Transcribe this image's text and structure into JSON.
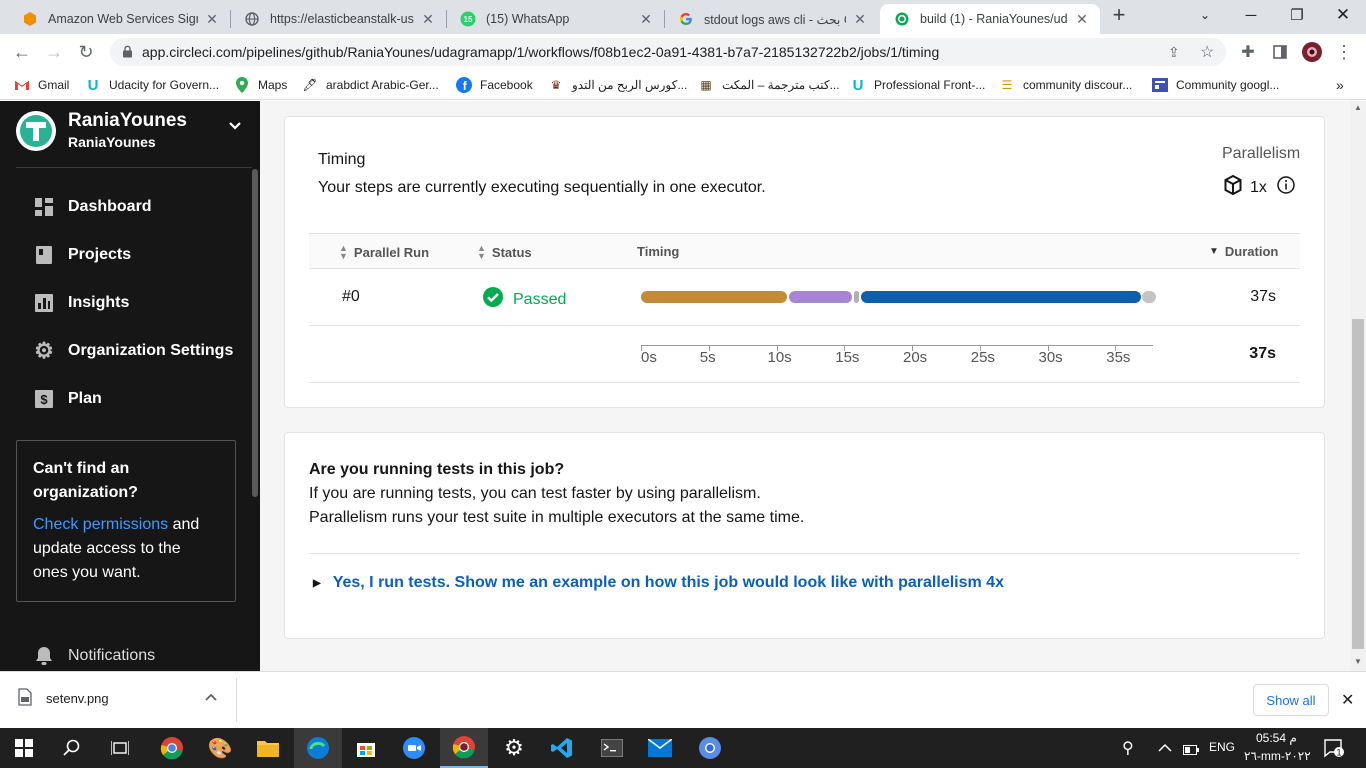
{
  "browser": {
    "tabs": [
      {
        "title": "Amazon Web Services Sign-I",
        "favicon": "aws-icon",
        "color": "#f29100"
      },
      {
        "title": "https://elasticbeanstalk-us-ea",
        "favicon": "globe-icon",
        "color": "#5f6368"
      },
      {
        "title": "(15) WhatsApp",
        "favicon": "whatsapp-icon",
        "color": "#25d366",
        "badge": "15"
      },
      {
        "title": "stdout logs aws cli - بحث Goo",
        "favicon": "google-icon",
        "color": "#4285f4"
      },
      {
        "title": "build (1) - RaniaYounes/udag",
        "favicon": "circleci-success-icon",
        "color": "#04aa51",
        "active": true
      }
    ],
    "url": "app.circleci.com/pipelines/github/RaniaYounes/udagramapp/1/workflows/f08b1ec2-0a91-4381-b7a7-2185132722b2/jobs/1/timing",
    "bookmarks": [
      {
        "label": "Gmail",
        "icon": "gmail-icon"
      },
      {
        "label": "Udacity for Govern...",
        "icon": "udacity-icon"
      },
      {
        "label": "Maps",
        "icon": "maps-icon"
      },
      {
        "label": "arabdict Arabic-Ger...",
        "icon": "arabdict-icon"
      },
      {
        "label": "Facebook",
        "icon": "facebook-icon"
      },
      {
        "label": "كورس الربح من التدو...",
        "icon": "course-icon"
      },
      {
        "label": "كتب مترجمة – المكت...",
        "icon": "books-icon"
      },
      {
        "label": "Professional Front-...",
        "icon": "udacity-icon"
      },
      {
        "label": "community discour...",
        "icon": "community-icon"
      },
      {
        "label": "Community googl...",
        "icon": "google-community-icon"
      }
    ]
  },
  "sidebar": {
    "org_name": "RaniaYounes",
    "org_sub": "RaniaYounes",
    "items": [
      {
        "label": "Dashboard",
        "icon": "dashboard-icon"
      },
      {
        "label": "Projects",
        "icon": "projects-icon"
      },
      {
        "label": "Insights",
        "icon": "insights-icon"
      },
      {
        "label": "Organization Settings",
        "icon": "gear-icon"
      },
      {
        "label": "Plan",
        "icon": "dollar-icon"
      }
    ],
    "cant_find": {
      "heading_1": "Can't find an",
      "heading_2": "organization?",
      "link": "Check permissions",
      "text_1": " and",
      "text_2": "update access to the",
      "text_3": "ones you want."
    },
    "notifications": "Notifications"
  },
  "timing": {
    "title": "Timing",
    "description": "Your steps are currently executing sequentially in one executor.",
    "parallelism_label": "Parallelism",
    "parallelism_value": "1x",
    "columns": {
      "parallel_run": "Parallel Run",
      "status": "Status",
      "timing": "Timing",
      "duration": "Duration"
    },
    "row": {
      "run": "#0",
      "status": "Passed",
      "duration": "37s"
    },
    "total_duration": "37s",
    "axis_ticks": [
      "0s",
      "5s",
      "10s",
      "15s",
      "20s",
      "25s",
      "30s",
      "35s"
    ],
    "axis_max_seconds": 37.5,
    "steps": [
      {
        "start": 0,
        "end": 10.8,
        "color": "#c48a35"
      },
      {
        "start": 10.9,
        "end": 15.6,
        "color": "#a884d6"
      },
      {
        "start": 15.7,
        "end": 16.1,
        "color": "#b0b0b0"
      },
      {
        "start": 16.2,
        "end": 36.9,
        "color": "#0d5fad"
      },
      {
        "start": 37.0,
        "end": 38.0,
        "color": "#c4c4c4"
      }
    ]
  },
  "tests": {
    "question": "Are you running tests in this job?",
    "line_1": "If you are running tests, you can test faster by using parallelism.",
    "line_2": "Parallelism runs your test suite in multiple executors at the same time.",
    "expand": "Yes, I run tests. Show me an example on how this job would look like with parallelism 4x"
  },
  "download": {
    "file": "setenv.png",
    "show_all": "Show all"
  },
  "taskbar": {
    "lang": "ENG",
    "time": "05:54 م",
    "date": "٢٦-mm-٢٠٢٢",
    "notif_count": "1"
  },
  "colors": {
    "success": "#04aa51",
    "link": "#0b5fc0",
    "sidebar_bg": "#161616"
  }
}
